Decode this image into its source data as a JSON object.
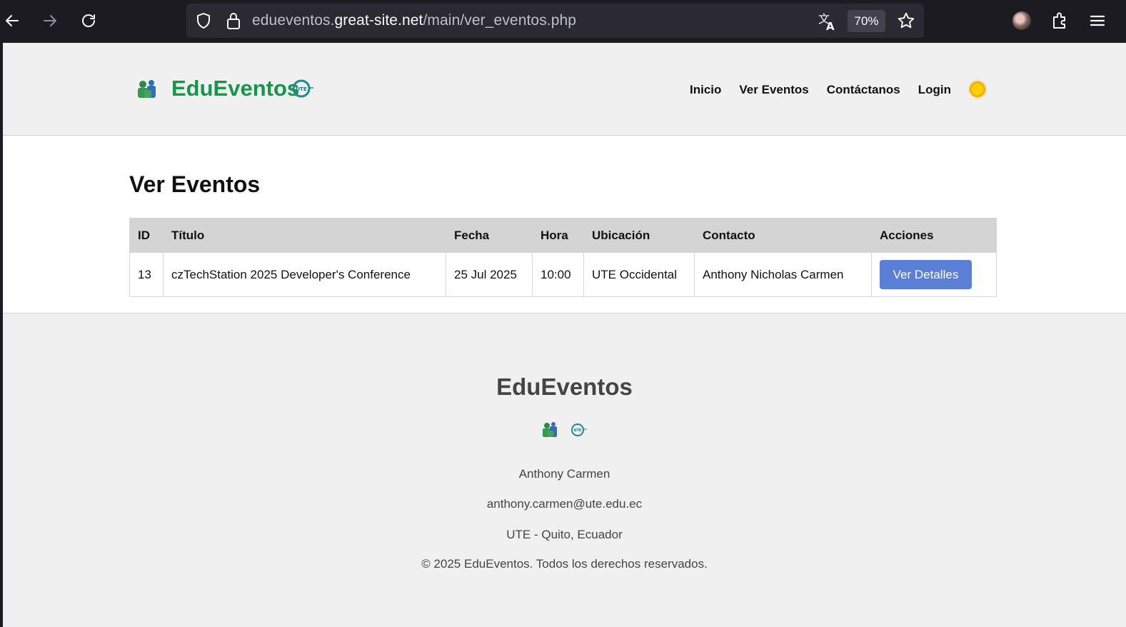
{
  "browser": {
    "url_prefix": "edueventos.",
    "url_domain": "great-site.net",
    "url_path": "/main/ver_eventos.php",
    "zoom": "70%"
  },
  "header": {
    "brand": "EduEventos",
    "nav": [
      "Inicio",
      "Ver Eventos",
      "Contáctanos",
      "Login"
    ]
  },
  "main": {
    "title": "Ver Eventos",
    "table": {
      "headers": [
        "ID",
        "Título",
        "Fecha",
        "Hora",
        "Ubicación",
        "Contacto",
        "Acciones"
      ],
      "rows": [
        {
          "id": "13",
          "titulo": "czTechStation 2025 Developer's Conference",
          "fecha": "25 Jul 2025",
          "hora": "10:00",
          "ubicacion": "UTE Occidental",
          "contacto": "Anthony Nicholas Carmen",
          "accion": "Ver Detalles"
        }
      ]
    }
  },
  "footer": {
    "title": "EduEventos",
    "name": "Anthony Carmen",
    "email": "anthony.carmen@ute.edu.ec",
    "location": "UTE - Quito, Ecuador",
    "copyright": "© 2025 EduEventos. Todos los derechos reservados."
  },
  "colors": {
    "brand_green": "#17954a",
    "button_blue": "#5b7fd6",
    "header_bg": "#f0f0f0",
    "table_header_bg": "#d4d4d4",
    "browser_bg": "#1c1b22"
  }
}
